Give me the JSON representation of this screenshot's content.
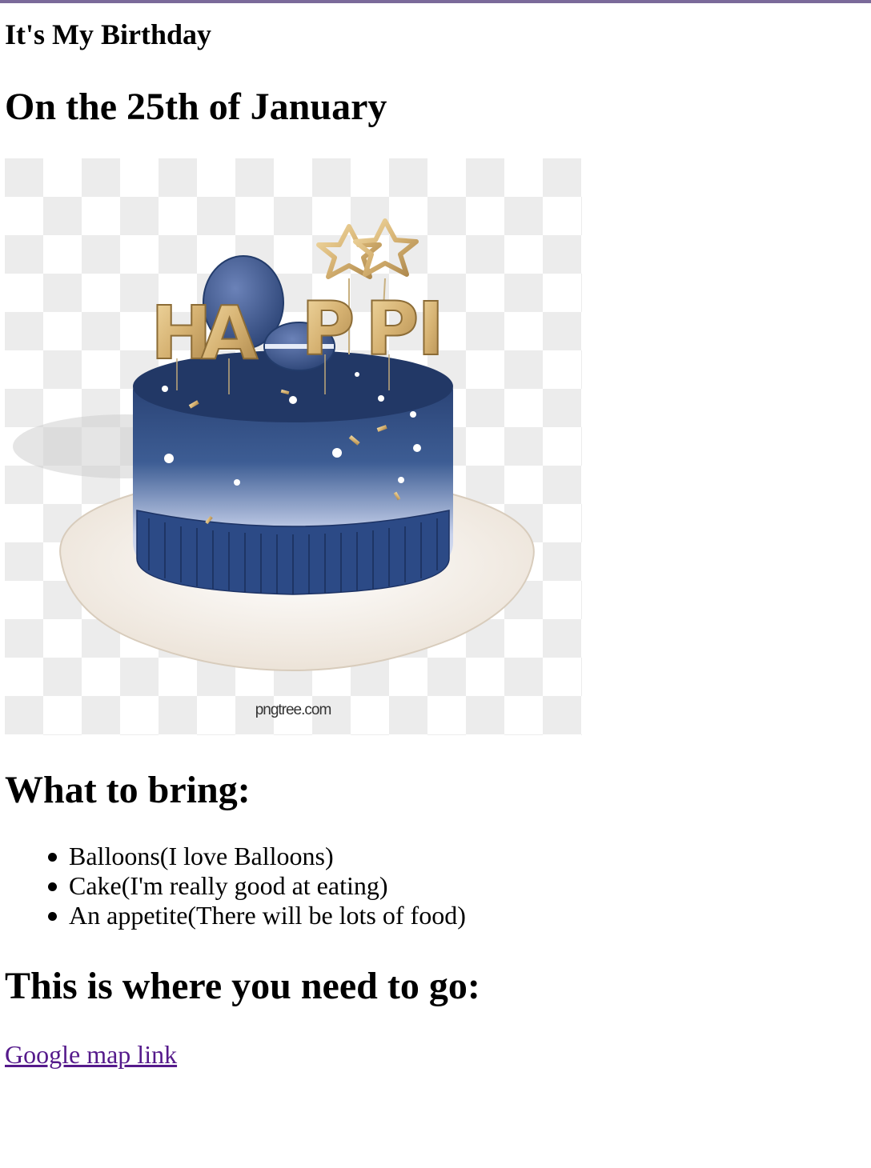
{
  "page": {
    "heading_small": "It's My Birthday",
    "heading_date": "On the 25th of January",
    "image": {
      "icon": "birthday-cake-image",
      "topper_text": "HAPPI",
      "watermark": "pngtree.com"
    },
    "bring_heading": "What to bring:",
    "bring_items": [
      "Balloons(I love Balloons)",
      "Cake(I'm really good at eating)",
      "An appetite(There will be lots of food)"
    ],
    "where_heading": "This is where you need to go:",
    "map_link_label": "Google map link"
  },
  "colors": {
    "top_bar": "#7b6a9a",
    "visited_link": "#551a8b",
    "cake_navy": "#2d4577",
    "gold": "#d8b878"
  }
}
